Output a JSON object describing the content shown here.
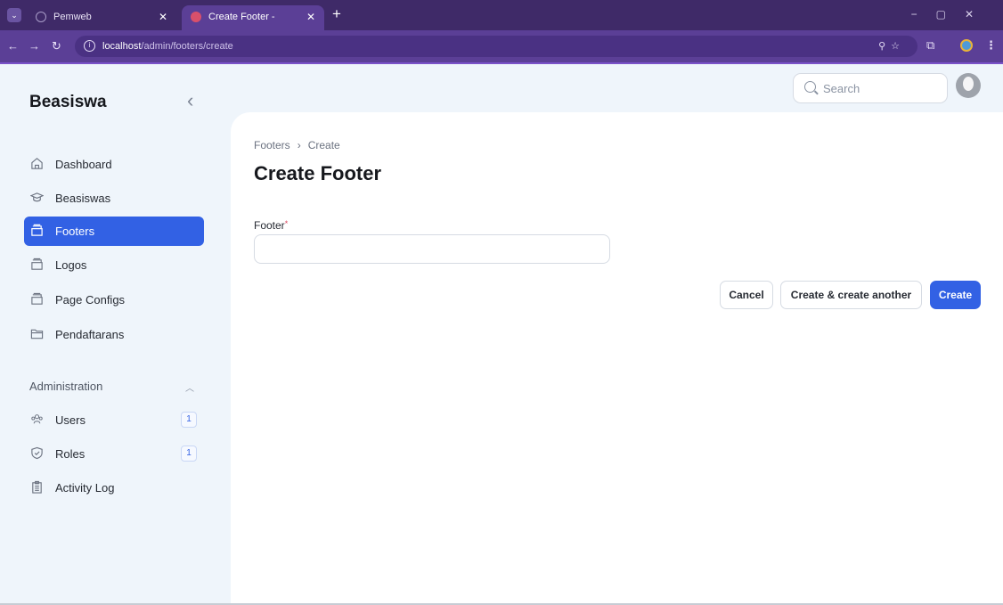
{
  "browser": {
    "tabs": [
      {
        "title": "Pemweb"
      },
      {
        "title": "Create Footer - Beasiswa"
      }
    ],
    "url_host": "localhost",
    "url_path": "/admin/footers/create"
  },
  "app": {
    "brand": "Beasiswa",
    "search_placeholder": "Search"
  },
  "sidebar": {
    "items": [
      {
        "label": "Dashboard"
      },
      {
        "label": "Beasiswas"
      },
      {
        "label": "Footers",
        "active": true
      },
      {
        "label": "Logos"
      },
      {
        "label": "Page Configs"
      },
      {
        "label": "Pendaftarans"
      }
    ],
    "admin_group": {
      "label": "Administration",
      "items": [
        {
          "label": "Users",
          "count": "1"
        },
        {
          "label": "Roles",
          "count": "1"
        },
        {
          "label": "Activity Log"
        }
      ]
    }
  },
  "page": {
    "breadcrumb": [
      "Footers",
      "Create"
    ],
    "title": "Create Footer",
    "form": {
      "footer_label": "Footer",
      "footer_required_mark": "*",
      "footer_value": ""
    },
    "buttons": {
      "cancel": "Cancel",
      "create_another": "Create & create another",
      "create": "Create"
    }
  },
  "colors": {
    "primary": "#3261e4",
    "browser_frame": "#5b3f96"
  }
}
